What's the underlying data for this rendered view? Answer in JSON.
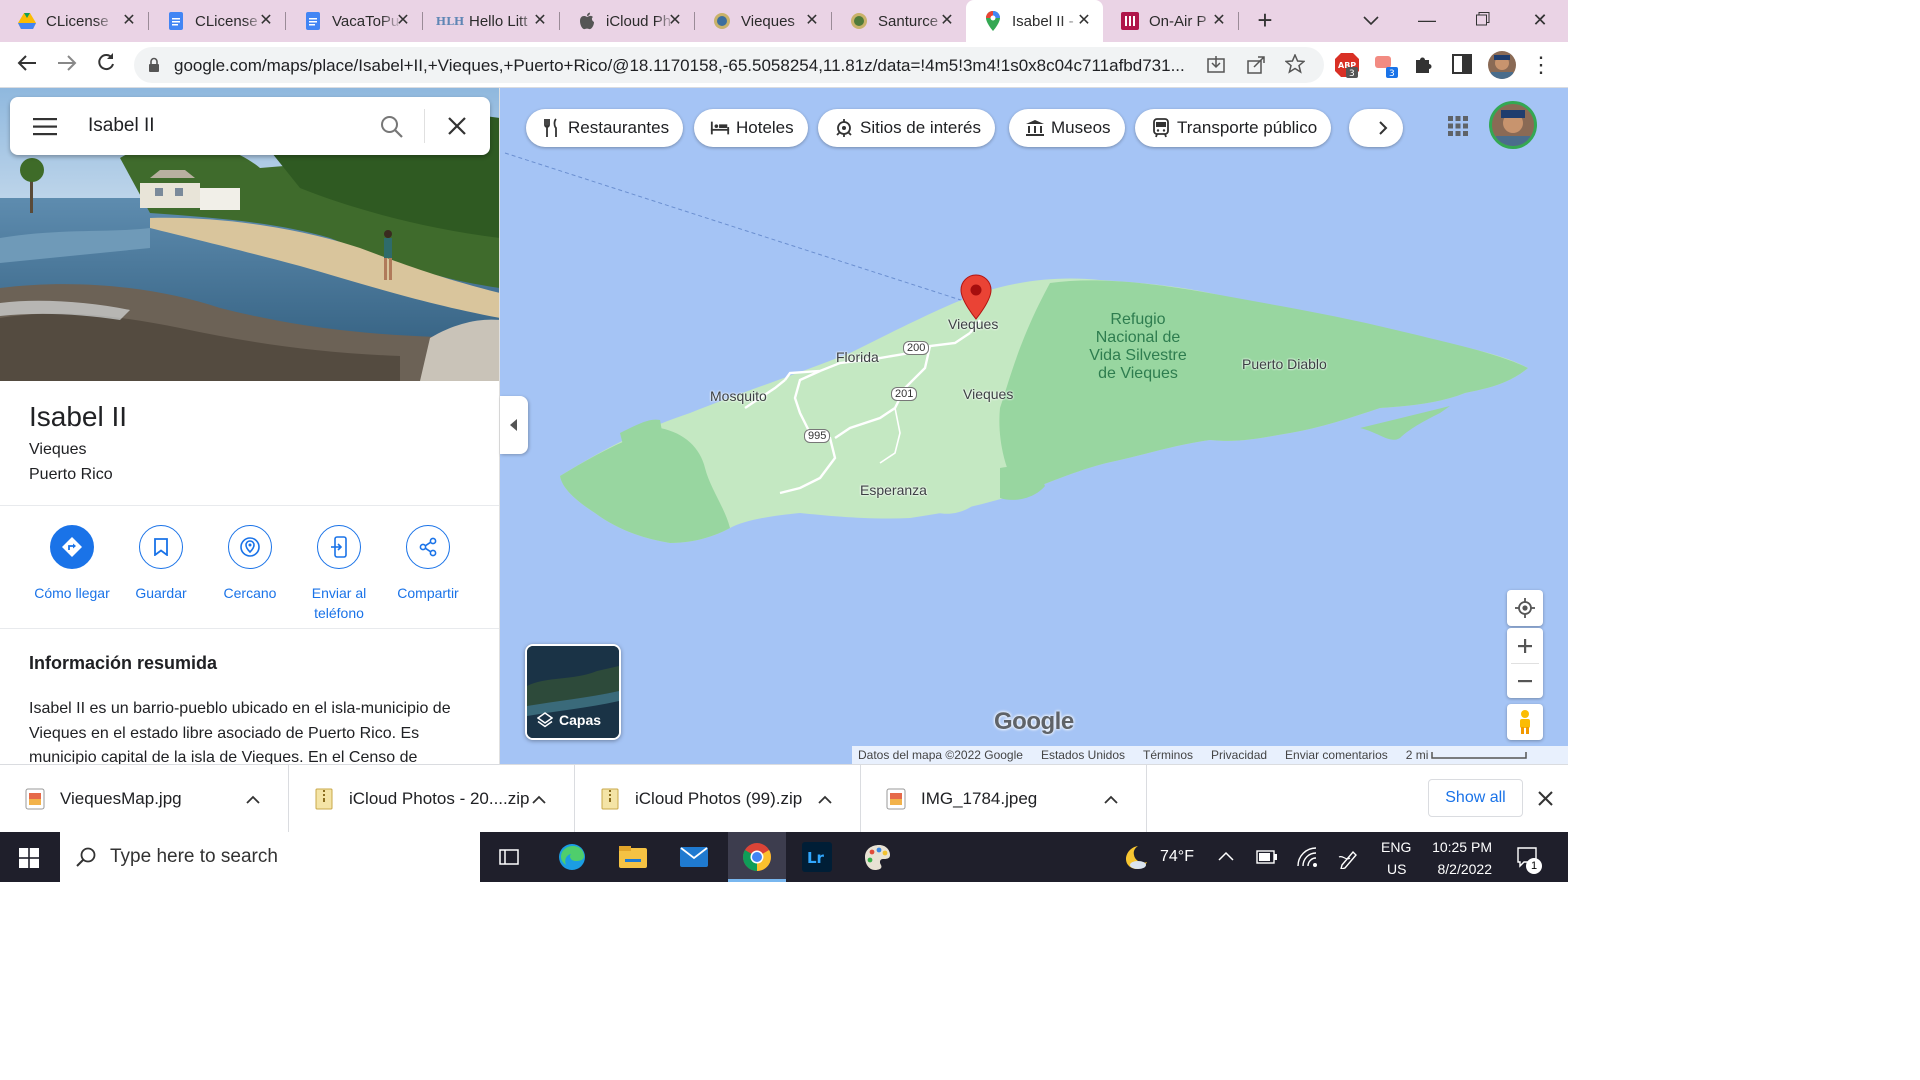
{
  "browser": {
    "tabs": [
      {
        "title": "CLicense",
        "icon": "google-drive-icon",
        "active": false
      },
      {
        "title": "CLicense",
        "icon": "google-docs-icon",
        "active": false
      },
      {
        "title": "VacaToPu",
        "icon": "google-docs-icon",
        "active": false
      },
      {
        "title": "Hello Litt",
        "icon": "hlh-icon",
        "active": false
      },
      {
        "title": "iCloud Ph",
        "icon": "apple-icon",
        "active": false
      },
      {
        "title": "Vieques",
        "icon": "vieques-seal-icon",
        "active": false
      },
      {
        "title": "Santurce",
        "icon": "santurce-seal-icon",
        "active": false
      },
      {
        "title": "Isabel II -",
        "icon": "google-maps-pin-icon",
        "active": true
      },
      {
        "title": "On-Air P",
        "icon": "onair-icon",
        "active": false
      }
    ],
    "url": "google.com/maps/place/Isabel+II,+Vieques,+Puerto+Rico/@18.1170158,-65.5058254,11.81z/data=!4m5!3m4!1s0x8c04c711afbd731..."
  },
  "panel": {
    "search_value": "Isabel II",
    "place_title": "Isabel II",
    "place_sub1": "Vieques",
    "place_sub2": "Puerto Rico",
    "actions": [
      {
        "label": "Cómo llegar",
        "icon": "directions-icon"
      },
      {
        "label": "Guardar",
        "icon": "bookmark-icon"
      },
      {
        "label": "Cercano",
        "icon": "nearby-icon"
      },
      {
        "label": "Enviar al teléfono",
        "icon": "send-to-phone-icon"
      },
      {
        "label": "Compartir",
        "icon": "share-icon"
      }
    ],
    "summary_title": "Información resumida",
    "summary_text": "Isabel II es un barrio-pueblo ubicado en el isla-municipio de Vieques en el estado libre asociado de Puerto Rico. Es municipio capital de la isla de Vieques. En el Censo de"
  },
  "map": {
    "chips": [
      {
        "label": "Restaurantes",
        "icon": "restaurant-icon"
      },
      {
        "label": "Hoteles",
        "icon": "hotel-icon"
      },
      {
        "label": "Sitios de interés",
        "icon": "attraction-icon"
      },
      {
        "label": "Museos",
        "icon": "museum-icon"
      },
      {
        "label": "Transporte público",
        "icon": "transit-icon"
      }
    ],
    "labels": {
      "vieques_pin": "Vieques",
      "florida": "Florida",
      "mosquito": "Mosquito",
      "vieques_center": "Vieques",
      "esperanza": "Esperanza",
      "puerto_diablo": "Puerto Diablo",
      "refugio": "Refugio Nacional de Vida Silvestre de Vieques"
    },
    "routes": [
      "200",
      "201",
      "995"
    ],
    "layers_label": "Capas",
    "logo": "Google",
    "footer": {
      "data": "Datos del mapa ©2022 Google",
      "country": "Estados Unidos",
      "terms": "Términos",
      "privacy": "Privacidad",
      "feedback": "Enviar comentarios",
      "scale": "2 mi"
    }
  },
  "downloads": {
    "items": [
      {
        "name": "ViequesMap.jpg",
        "icon": "image-file-icon"
      },
      {
        "name": "iCloud Photos - 20....zip",
        "icon": "zip-file-icon"
      },
      {
        "name": "iCloud Photos (99).zip",
        "icon": "zip-file-icon"
      },
      {
        "name": "IMG_1784.jpeg",
        "icon": "image-file-icon"
      }
    ],
    "show_all": "Show all"
  },
  "taskbar": {
    "search_placeholder": "Type here to search",
    "temperature": "74°F",
    "lang1": "ENG",
    "lang2": "US",
    "time": "10:25 PM",
    "date": "8/2/2022",
    "notifications": "1"
  }
}
